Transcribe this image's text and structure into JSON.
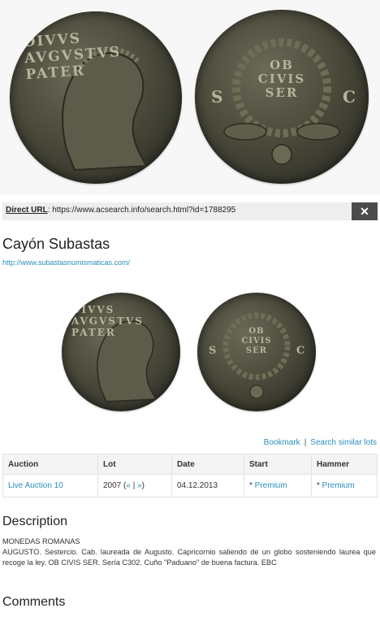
{
  "hero": {
    "obverse_legend": "DIVVS AVGVSTVS PATER",
    "reverse_legend_lines": [
      "OB",
      "CIVIS",
      "SER"
    ],
    "reverse_side_letters": [
      "S",
      "C"
    ]
  },
  "url_bar": {
    "label": "Direct URL",
    "url": "https://www.acsearch.info/search.html?id=1788295",
    "close_icon": "close-icon"
  },
  "seller": {
    "name": "Cayón Subastas",
    "url": "http://www.subastasnumismaticas.com/"
  },
  "actions": {
    "bookmark": "Bookmark",
    "separator": "|",
    "search_similar": "Search similar lots"
  },
  "table": {
    "headers": [
      "Auction",
      "Lot",
      "Date",
      "Start",
      "Hammer"
    ],
    "row": {
      "auction": "Live Auction 10",
      "lot": "2007",
      "lot_prev": "«",
      "lot_sep": "|",
      "lot_next": "»",
      "date": "04.12.2013",
      "start": "Premium",
      "hammer": "Premium"
    }
  },
  "description": {
    "heading": "Description",
    "line1": "MONEDAS ROMANAS",
    "line2": "AUGUSTO. Sestercio. Cab. laureada de Augusto. Capricornio saliendo de un globo sosteniendo laurea que recoge la ley. OB CIVIS SER. Sería C302. Cuño \"Paduano\" de buena factura. EBC"
  },
  "comments": {
    "heading": "Comments"
  },
  "colors": {
    "link": "#2a8fbd",
    "close_button_bg": "#4b4b4b",
    "coin_bronze": "#4c4b3c"
  }
}
